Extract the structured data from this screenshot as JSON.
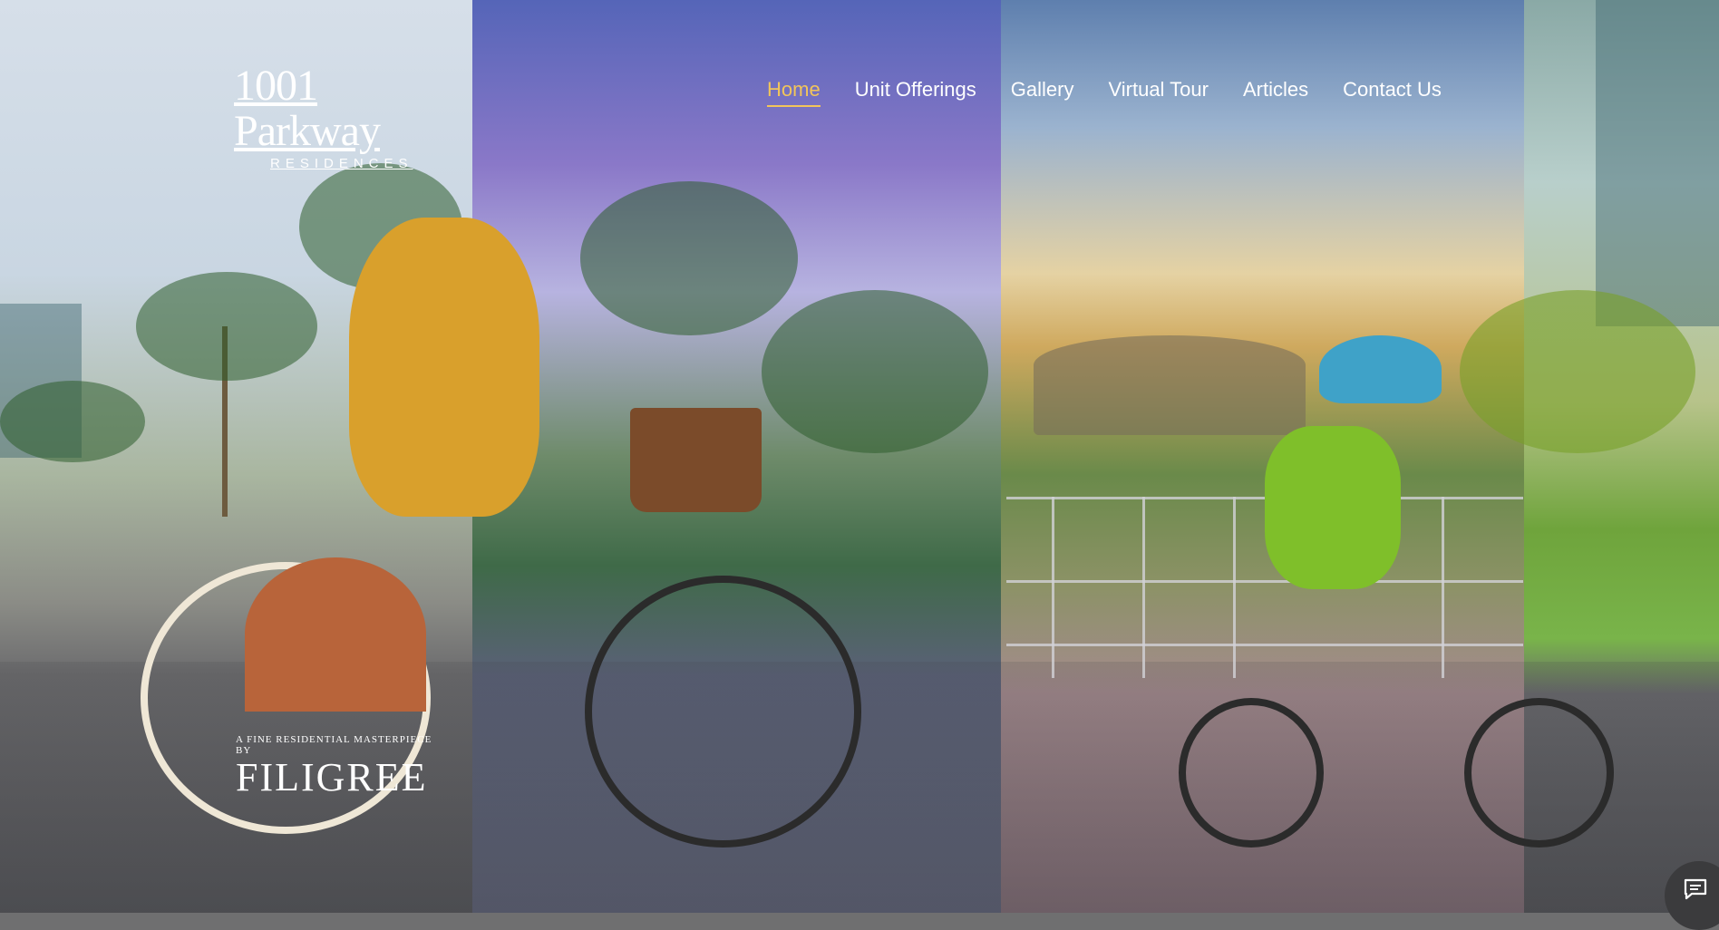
{
  "logo": {
    "main": "1001 Parkway",
    "sub": "RESIDENCES"
  },
  "nav": {
    "items": [
      {
        "label": "Home",
        "active": true
      },
      {
        "label": "Unit Offerings",
        "active": false
      },
      {
        "label": "Gallery",
        "active": false
      },
      {
        "label": "Virtual Tour",
        "active": false
      },
      {
        "label": "Articles",
        "active": false
      },
      {
        "label": "Contact Us",
        "active": false
      }
    ]
  },
  "hero": {
    "tagline": "A FINE RESIDENTIAL MASTERPIECE BY",
    "brand": "FILIGREE"
  },
  "chat": {
    "icon": "chat-icon"
  },
  "colors": {
    "nav_active": "#f2c55a",
    "nav_text": "#ffffff",
    "chat_bg": "#3b3b3d"
  }
}
